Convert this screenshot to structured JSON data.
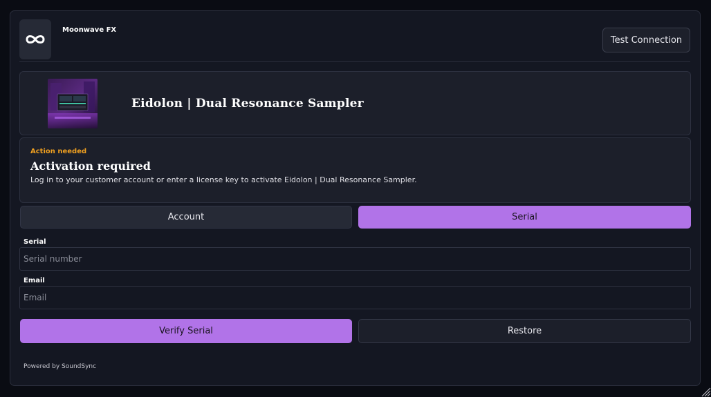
{
  "header": {
    "brand": "Moonwave FX",
    "logo_icon": "infinity-icon",
    "test_connection_label": "Test Connection"
  },
  "product": {
    "title": "Eidolon | Dual Resonance Sampler",
    "thumbnail_icon": "product-artwork"
  },
  "notice": {
    "tag": "Action needed",
    "title": "Activation required",
    "description": "Log in to your customer account or enter a license key to activate Eidolon | Dual Resonance Sampler."
  },
  "tabs": [
    {
      "label": "Account",
      "active": false
    },
    {
      "label": "Serial",
      "active": true
    }
  ],
  "form": {
    "serial": {
      "label": "Serial",
      "value": "",
      "placeholder": "Serial number"
    },
    "email": {
      "label": "Email",
      "value": "",
      "placeholder": "Email"
    }
  },
  "actions": {
    "verify_label": "Verify Serial",
    "restore_label": "Restore"
  },
  "footer": {
    "powered_by": "Powered by SoundSync"
  },
  "colors": {
    "accent": "#b173e8",
    "warning": "#f0a020",
    "background": "#141722",
    "card": "#1c1f2a"
  }
}
